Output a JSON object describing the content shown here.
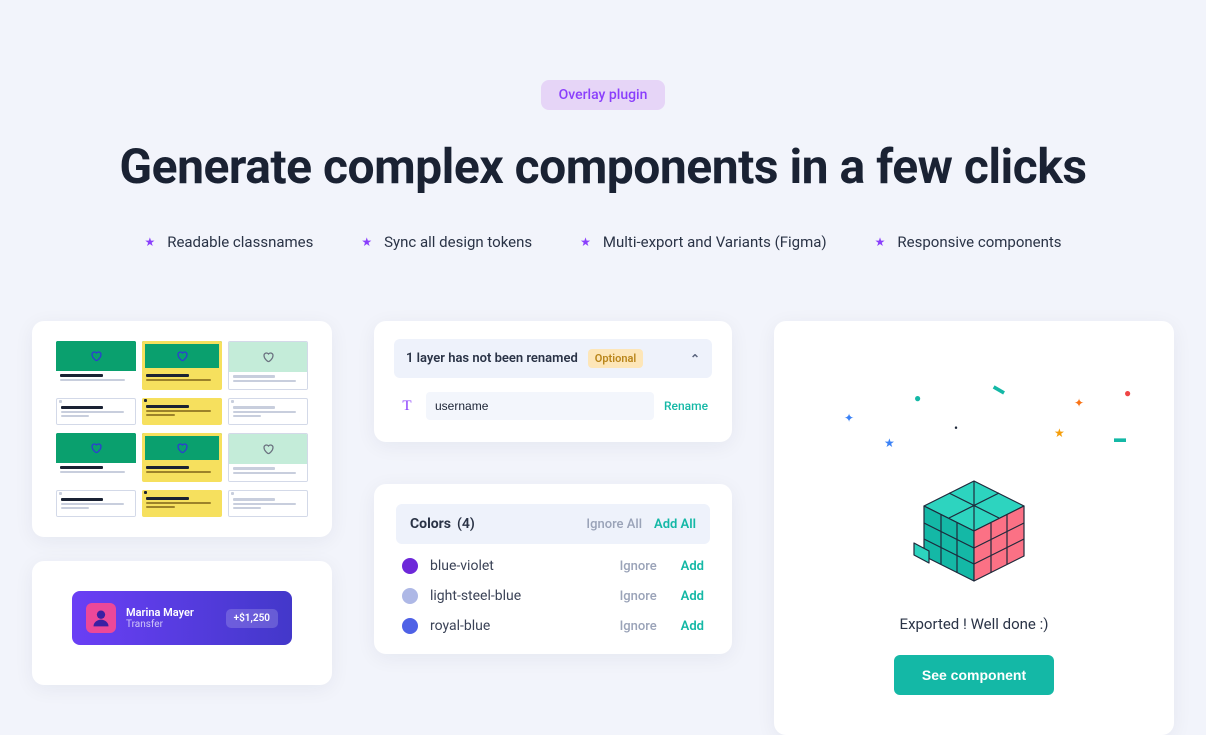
{
  "header": {
    "badge": "Overlay plugin",
    "title": "Generate complex components in a few clicks",
    "features": [
      "Readable classnames",
      "Sync all design tokens",
      "Multi-export and Variants (Figma)",
      "Responsive components"
    ]
  },
  "rename_panel": {
    "heading": "1 layer has not been renamed",
    "optional_badge": "Optional",
    "input_value": "username",
    "rename_action": "Rename"
  },
  "colors_panel": {
    "label": "Colors",
    "count": "(4)",
    "ignore_all": "Ignore All",
    "add_all": "Add All",
    "ignore": "Ignore",
    "add": "Add",
    "items": [
      {
        "name": "blue-violet",
        "hex": "#6d28d9"
      },
      {
        "name": "light-steel-blue",
        "hex": "#aeb8e6"
      },
      {
        "name": "royal-blue",
        "hex": "#4f61e6"
      }
    ]
  },
  "transfer_card": {
    "name": "Marina Mayer",
    "sub": "Transfer",
    "amount": "+$1,250"
  },
  "success_card": {
    "message": "Exported ! Well done :)",
    "button": "See component"
  },
  "colors": {
    "accent_purple": "#8a3ffc",
    "accent_teal": "#14b8a6"
  }
}
